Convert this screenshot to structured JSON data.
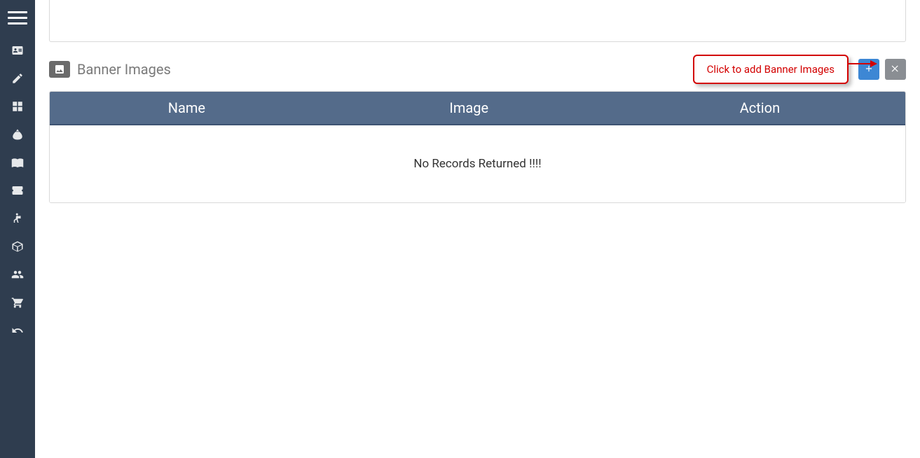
{
  "sidebar": {
    "items": [
      {
        "name": "card"
      },
      {
        "name": "edit"
      },
      {
        "name": "grid"
      },
      {
        "name": "money"
      },
      {
        "name": "book"
      },
      {
        "name": "ticket"
      },
      {
        "name": "courier"
      },
      {
        "name": "package"
      },
      {
        "name": "users"
      },
      {
        "name": "cart"
      },
      {
        "name": "undo"
      }
    ]
  },
  "panel": {
    "title": "Banner Images",
    "callout": "Click to add Banner Images",
    "columns": {
      "name": "Name",
      "image": "Image",
      "action": "Action"
    },
    "empty_message": "No Records Returned !!!!"
  },
  "colors": {
    "sidebar_bg": "#2f3d4f",
    "header_bg": "#546b8a",
    "btn_add": "#3d87d4",
    "btn_close": "#8a8e93",
    "callout_border": "#d30000"
  }
}
